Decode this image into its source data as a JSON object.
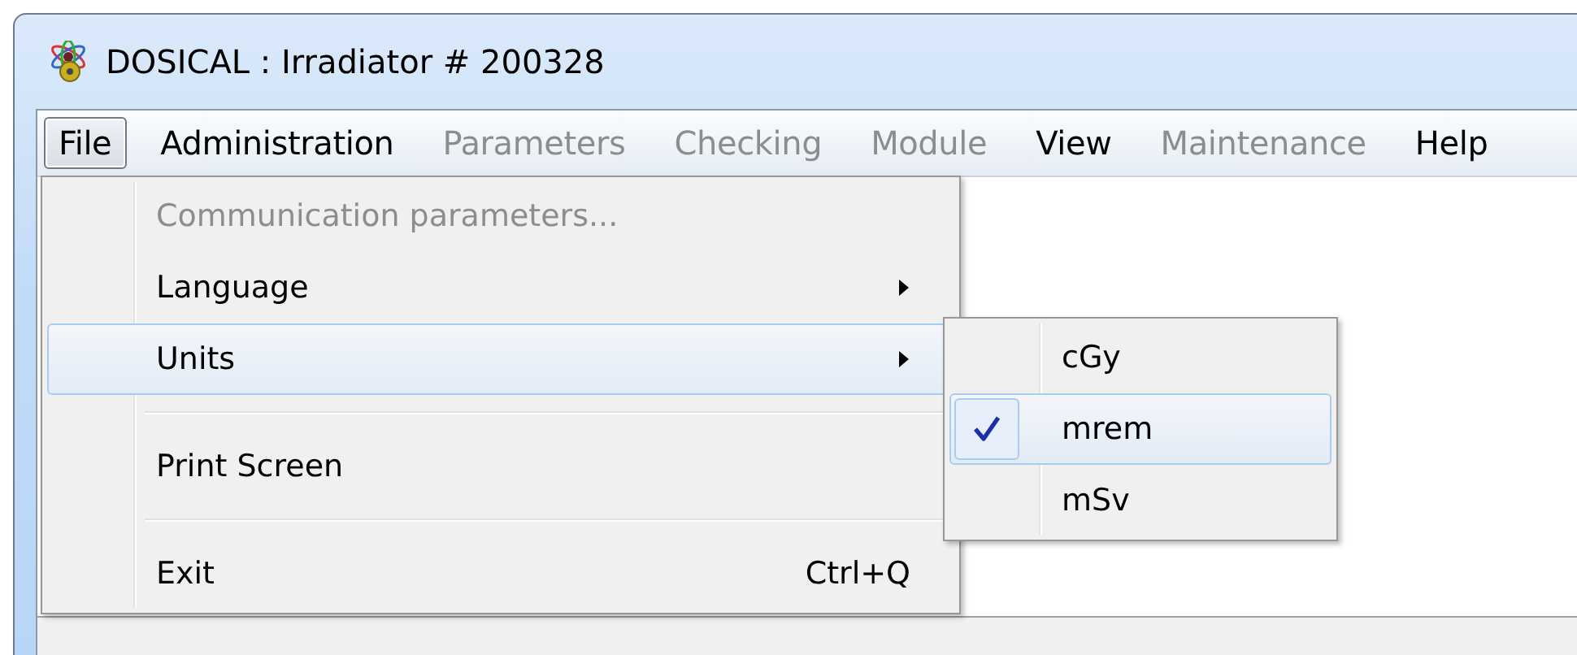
{
  "window": {
    "title": "DOSICAL : Irradiator # 200328"
  },
  "menubar": [
    {
      "label": "File",
      "selected": true,
      "disabled": false
    },
    {
      "label": "Administration",
      "selected": false,
      "disabled": false
    },
    {
      "label": "Parameters",
      "selected": false,
      "disabled": true
    },
    {
      "label": "Checking",
      "selected": false,
      "disabled": true
    },
    {
      "label": "Module",
      "selected": false,
      "disabled": true
    },
    {
      "label": "View",
      "selected": false,
      "disabled": false
    },
    {
      "label": "Maintenance",
      "selected": false,
      "disabled": true
    },
    {
      "label": "Help",
      "selected": false,
      "disabled": false
    }
  ],
  "file_menu": [
    {
      "kind": "item",
      "label": "Communication parameters...",
      "disabled": true,
      "submenu": false,
      "selected": false
    },
    {
      "kind": "item",
      "label": "Language",
      "disabled": false,
      "submenu": true,
      "selected": false
    },
    {
      "kind": "item",
      "label": "Units",
      "disabled": false,
      "submenu": true,
      "selected": true
    },
    {
      "kind": "separator"
    },
    {
      "kind": "item",
      "label": "Print Screen",
      "disabled": false,
      "submenu": false,
      "selected": false
    },
    {
      "kind": "separator"
    },
    {
      "kind": "item",
      "label": "Exit",
      "shortcut": "Ctrl+Q",
      "disabled": false,
      "submenu": false,
      "selected": false
    }
  ],
  "units_submenu": [
    {
      "label": "cGy",
      "checked": false,
      "selected": false
    },
    {
      "label": "mrem",
      "checked": true,
      "selected": true
    },
    {
      "label": "mSv",
      "checked": false,
      "selected": false
    }
  ]
}
